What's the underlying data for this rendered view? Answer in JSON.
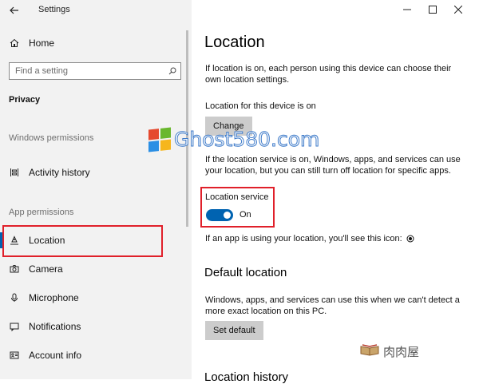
{
  "window": {
    "title": "Settings",
    "controls": [
      "minimize",
      "maximize",
      "close"
    ]
  },
  "sidebar": {
    "home_label": "Home",
    "search_placeholder": "Find a setting",
    "section": "Privacy",
    "group_windows": "Windows permissions",
    "windows_items": [
      {
        "label": "Activity history",
        "icon": "activity-history-icon"
      }
    ],
    "group_app": "App permissions",
    "app_items": [
      {
        "label": "Location",
        "icon": "location-icon",
        "selected": true
      },
      {
        "label": "Camera",
        "icon": "camera-icon"
      },
      {
        "label": "Microphone",
        "icon": "microphone-icon"
      },
      {
        "label": "Notifications",
        "icon": "notifications-icon"
      },
      {
        "label": "Account info",
        "icon": "account-info-icon"
      }
    ]
  },
  "main": {
    "title": "Location",
    "intro": "If location is on, each person using this device can choose their own location settings.",
    "device_status": "Location for this device is on",
    "change_label": "Change",
    "service_desc": "If the location service is on, Windows, apps, and services can use your location, but you can still turn off location for specific apps.",
    "service_label": "Location service",
    "toggle_state": "On",
    "icon_hint": "If an app is using your location, you'll see this icon:",
    "default_heading": "Default location",
    "default_desc": "Windows, apps, and services can use this when we can't detect a more exact location on this PC.",
    "set_default_label": "Set default",
    "history_heading": "Location history"
  },
  "watermarks": {
    "site": "Ghost580.com",
    "corner": "肉肉屋"
  },
  "colors": {
    "accent": "#0063b1",
    "highlight_box": "#e0202a",
    "sidebar_bg": "#f2f2f2",
    "button_bg": "#cccccc"
  }
}
